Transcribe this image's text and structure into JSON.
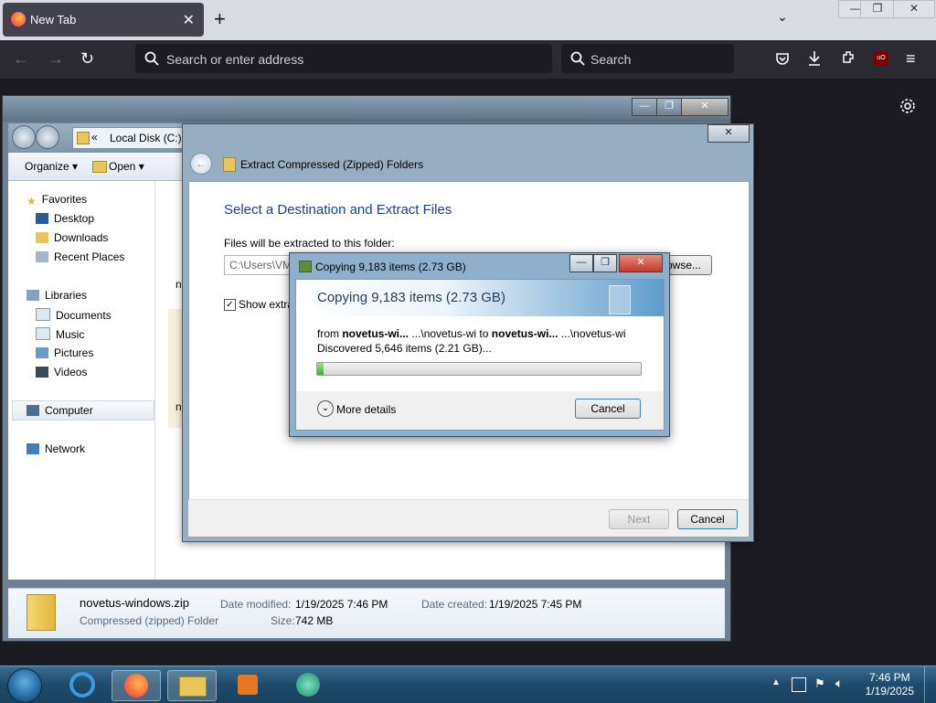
{
  "browser": {
    "tab_title": "New Tab",
    "tab_close": "✕",
    "new_tab": "+",
    "list_all_tabs": "⌄",
    "window_min": "—",
    "window_max": "❐",
    "window_close": "✕",
    "url_placeholder": "Search or enter address",
    "search_placeholder": "Search",
    "ublock_label": "uO"
  },
  "explorer": {
    "address": "Local Disk (C:)",
    "address_back_chevrons": "«",
    "toolbar": {
      "organize": "Organize",
      "open": "Open"
    },
    "nav": {
      "favorites": "Favorites",
      "desktop": "Desktop",
      "downloads": "Downloads",
      "recent_places": "Recent Places",
      "libraries": "Libraries",
      "documents": "Documents",
      "music": "Music",
      "pictures": "Pictures",
      "videos": "Videos",
      "computer": "Computer",
      "network": "Network"
    },
    "main_fragments": [
      "n",
      "n"
    ],
    "details": {
      "filename": "novetus-windows.zip",
      "type": "Compressed (zipped) Folder",
      "date_modified_label": "Date modified:",
      "date_modified": "1/19/2025 7:46 PM",
      "size_label": "Size:",
      "size": "742 MB",
      "date_created_label": "Date created:",
      "date_created": "1/19/2025 7:45 PM"
    }
  },
  "wizard": {
    "title": "Extract Compressed (Zipped) Folders",
    "heading": "Select a Destination and Extract Files",
    "dest_label": "Files will be extracted to this folder:",
    "dest_value": "C:\\Users\\VM",
    "browse": "Browse...",
    "show_files": "Show extra",
    "show_checked": true,
    "next": "Next",
    "cancel": "Cancel",
    "close": "✕"
  },
  "copy_dialog": {
    "title": "Copying 9,183 items (2.73 GB)",
    "heading": "Copying 9,183 items (2.73 GB)",
    "from_label": "from",
    "from_name": "novetus-wi...",
    "from_path": "...\\novetus-wi",
    "to_label": "to",
    "to_name": "novetus-wi...",
    "to_path": "...\\novetus-wi",
    "status": "Discovered 5,646 items (2.21 GB)...",
    "progress_fraction": 0.02,
    "more_details": "More details",
    "cancel": "Cancel"
  },
  "taskbar": {
    "time": "7:46 PM",
    "date": "1/19/2025"
  }
}
